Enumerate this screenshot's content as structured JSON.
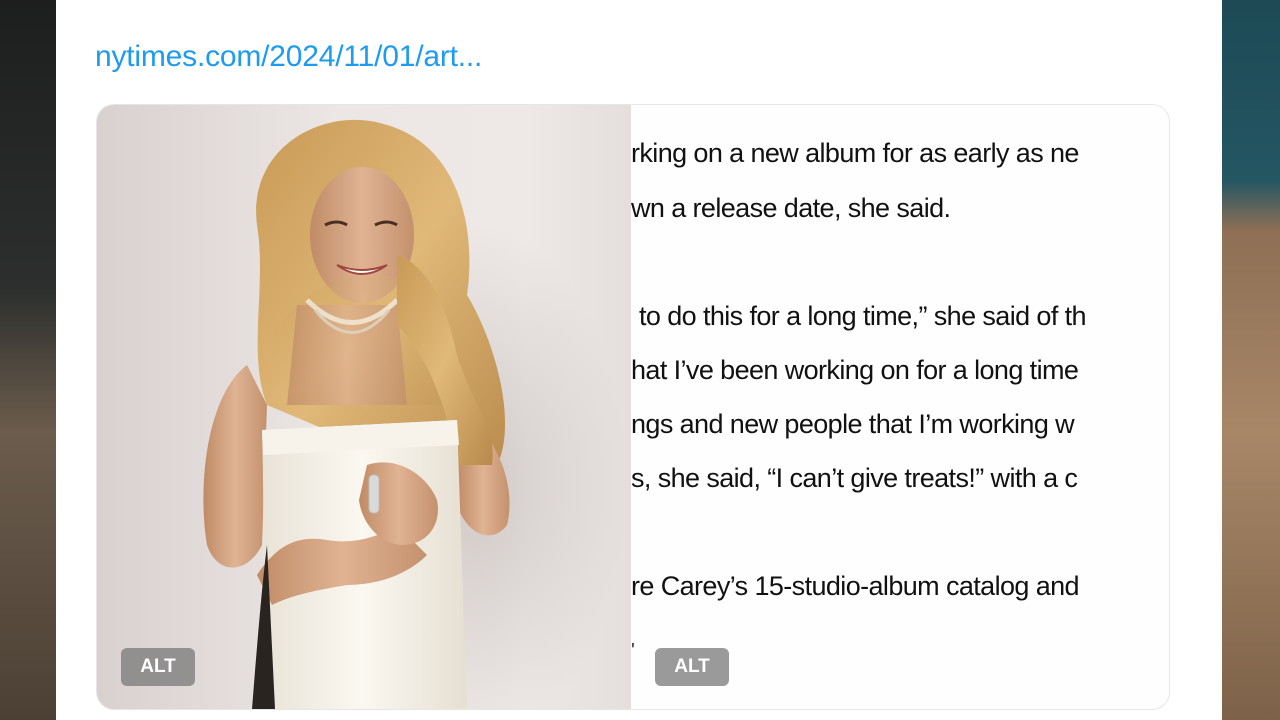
{
  "post": {
    "link_text": "nytimes.com/2024/11/01/art..."
  },
  "gallery": {
    "alt_label": "ALT",
    "text_image": {
      "lines": [
        "rking on a new album for as early as ne",
        "wn a release date, she said.",
        "",
        "to do this for a long time,” she said of th",
        "hat I’ve been working on for a long time",
        "ngs and new people that I’m working w",
        "s, she said, “I can’t give treats!” with a c",
        "",
        "re Carey’s 15-studio-album catalog and"
      ],
      "stray_mark": "'"
    }
  },
  "colors": {
    "link": "#1d9bf0",
    "card_bg": "#ffffff"
  }
}
